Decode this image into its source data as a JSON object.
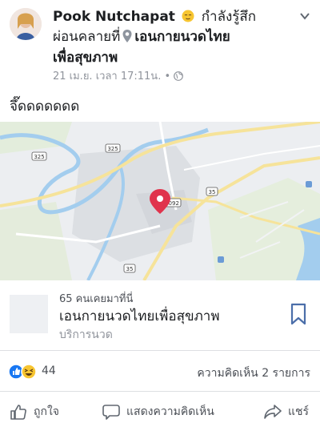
{
  "post": {
    "author": "Pook Nutchapat",
    "feeling_text": "กำลังรู้สึก",
    "feeling_word": "ผ่อนคลาย",
    "at_text": "ที่",
    "place_part1": "เอนกายนวดไทย",
    "place_part2": "เพื่อสุขภาพ",
    "timestamp": "21 เม.ย. เวลา 17:11น.",
    "separator": "•",
    "text": "จึ๊ดดดดดดด"
  },
  "map": {
    "labels": {
      "route_325_a": "325",
      "route_325_b": "325",
      "route_35_a": "35",
      "route_35_b": "35",
      "route_3092": "3092"
    }
  },
  "place_card": {
    "count_text": "65 คนเคยมาที่นี่",
    "name": "เอนกายนวดไทยเพื่อสุขภาพ",
    "category": "บริการนวด"
  },
  "engagement": {
    "reaction_count": "44",
    "comments_text": "ความคิดเห็น 2 รายการ"
  },
  "actions": {
    "like": "ถูกใจ",
    "comment": "แสดงความคิดเห็น",
    "share": "แชร์"
  },
  "colors": {
    "fb_blue": "#1877f2",
    "map_pin": "#e0334c",
    "water": "#a3cdee",
    "road_yellow": "#f6e39a"
  }
}
